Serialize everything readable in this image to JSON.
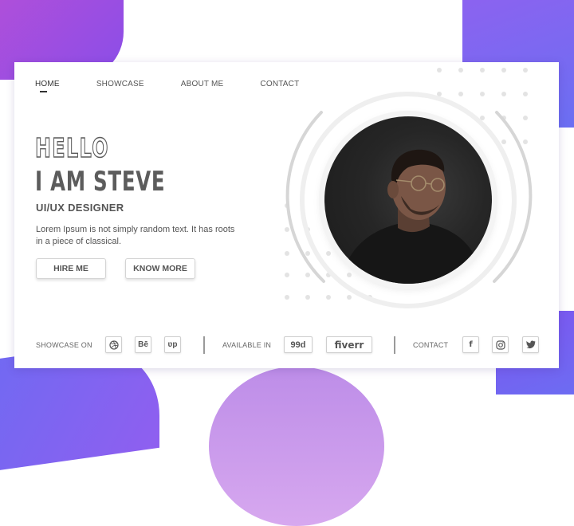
{
  "nav": {
    "items": [
      "HOME",
      "SHOWCASE",
      "ABOUT ME",
      "CONTACT"
    ]
  },
  "hero": {
    "greeting": "HELLO",
    "name": "I AM STEVE",
    "role": "UI/UX DESIGNER",
    "description": "Lorem Ipsum is not simply random text. It has roots in a piece of classical.",
    "hire_label": "HIRE ME",
    "more_label": "KNOW MORE"
  },
  "footer": {
    "showcase_label": "SHOWCASE ON",
    "showcase_icons": [
      "dribbble-icon",
      "behance-icon",
      "upwork-icon"
    ],
    "behance_text": "Bē",
    "upwork_text": "ʋp",
    "available_label": "AVAILABLE IN",
    "ninety_nine_text": "99d",
    "fiverr_text": "fiverr",
    "contact_label": "CONTACT",
    "contact_icons": [
      "facebook-icon",
      "instagram-icon",
      "twitter-icon"
    ],
    "facebook_text": "f"
  },
  "colors": {
    "accent_purple": "#8d62f0",
    "text_dark": "#555555"
  }
}
